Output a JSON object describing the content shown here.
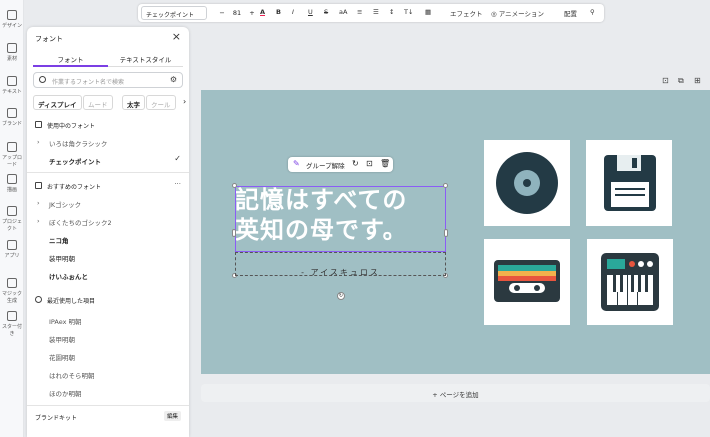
{
  "left_rail": [
    {
      "label": "デザイン",
      "icon": "design-icon"
    },
    {
      "label": "素材",
      "icon": "elements-icon"
    },
    {
      "label": "テキスト",
      "icon": "text-icon"
    },
    {
      "label": "ブランド",
      "icon": "brand-icon"
    },
    {
      "label": "アップロード",
      "icon": "upload-icon"
    },
    {
      "label": "描画",
      "icon": "draw-icon"
    },
    {
      "label": "プロジェクト",
      "icon": "project-icon"
    },
    {
      "label": "アプリ",
      "icon": "apps-icon"
    },
    {
      "label": "マジック生成",
      "icon": "magic-icon"
    },
    {
      "label": "スター付き",
      "icon": "star-icon"
    }
  ],
  "panel": {
    "title": "フォント",
    "tabs": [
      "フォント",
      "テキストスタイル"
    ],
    "search_placeholder": "作業するフォント名で検索",
    "chips": [
      "ディスプレイ",
      "ムード",
      "太字",
      "クール"
    ],
    "section_used": "使用中のフォント",
    "used_fonts": [
      {
        "name": "いろは角クラシック",
        "expand": "›"
      },
      {
        "name": "チェックポイント",
        "selected": "✓"
      }
    ],
    "section_recommended": "おすすめのフォント",
    "recommended_fonts": [
      {
        "name": "JKゴシック",
        "expand": "›"
      },
      {
        "name": "ぼくたちのゴシック2",
        "expand": "›"
      },
      {
        "name": "ニコ角"
      },
      {
        "name": "装甲明朝"
      },
      {
        "name": "けいふぉんと"
      }
    ],
    "section_recent": "最近使用した項目",
    "recent_fonts": [
      {
        "name": "IPAex 明朝"
      },
      {
        "name": "装甲明朝"
      },
      {
        "name": "花園明朝"
      },
      {
        "name": "はれのそら明朝"
      },
      {
        "name": "ほのか明朝"
      }
    ],
    "brand_kit": "ブランドキット",
    "brand_tag": "編集"
  },
  "toolbar": {
    "font": "チェックポイント",
    "minus": "−",
    "size": "81",
    "plus": "+",
    "effect": "エフェクト",
    "animation": "アニメーション",
    "position": "配置"
  },
  "canvas": {
    "heading_line1": "記憶はすべての",
    "heading_line2": "英知の母です。",
    "author": "- アイスキュロス",
    "group_label": "グループ解除",
    "add_page": "+ ページを追加"
  }
}
